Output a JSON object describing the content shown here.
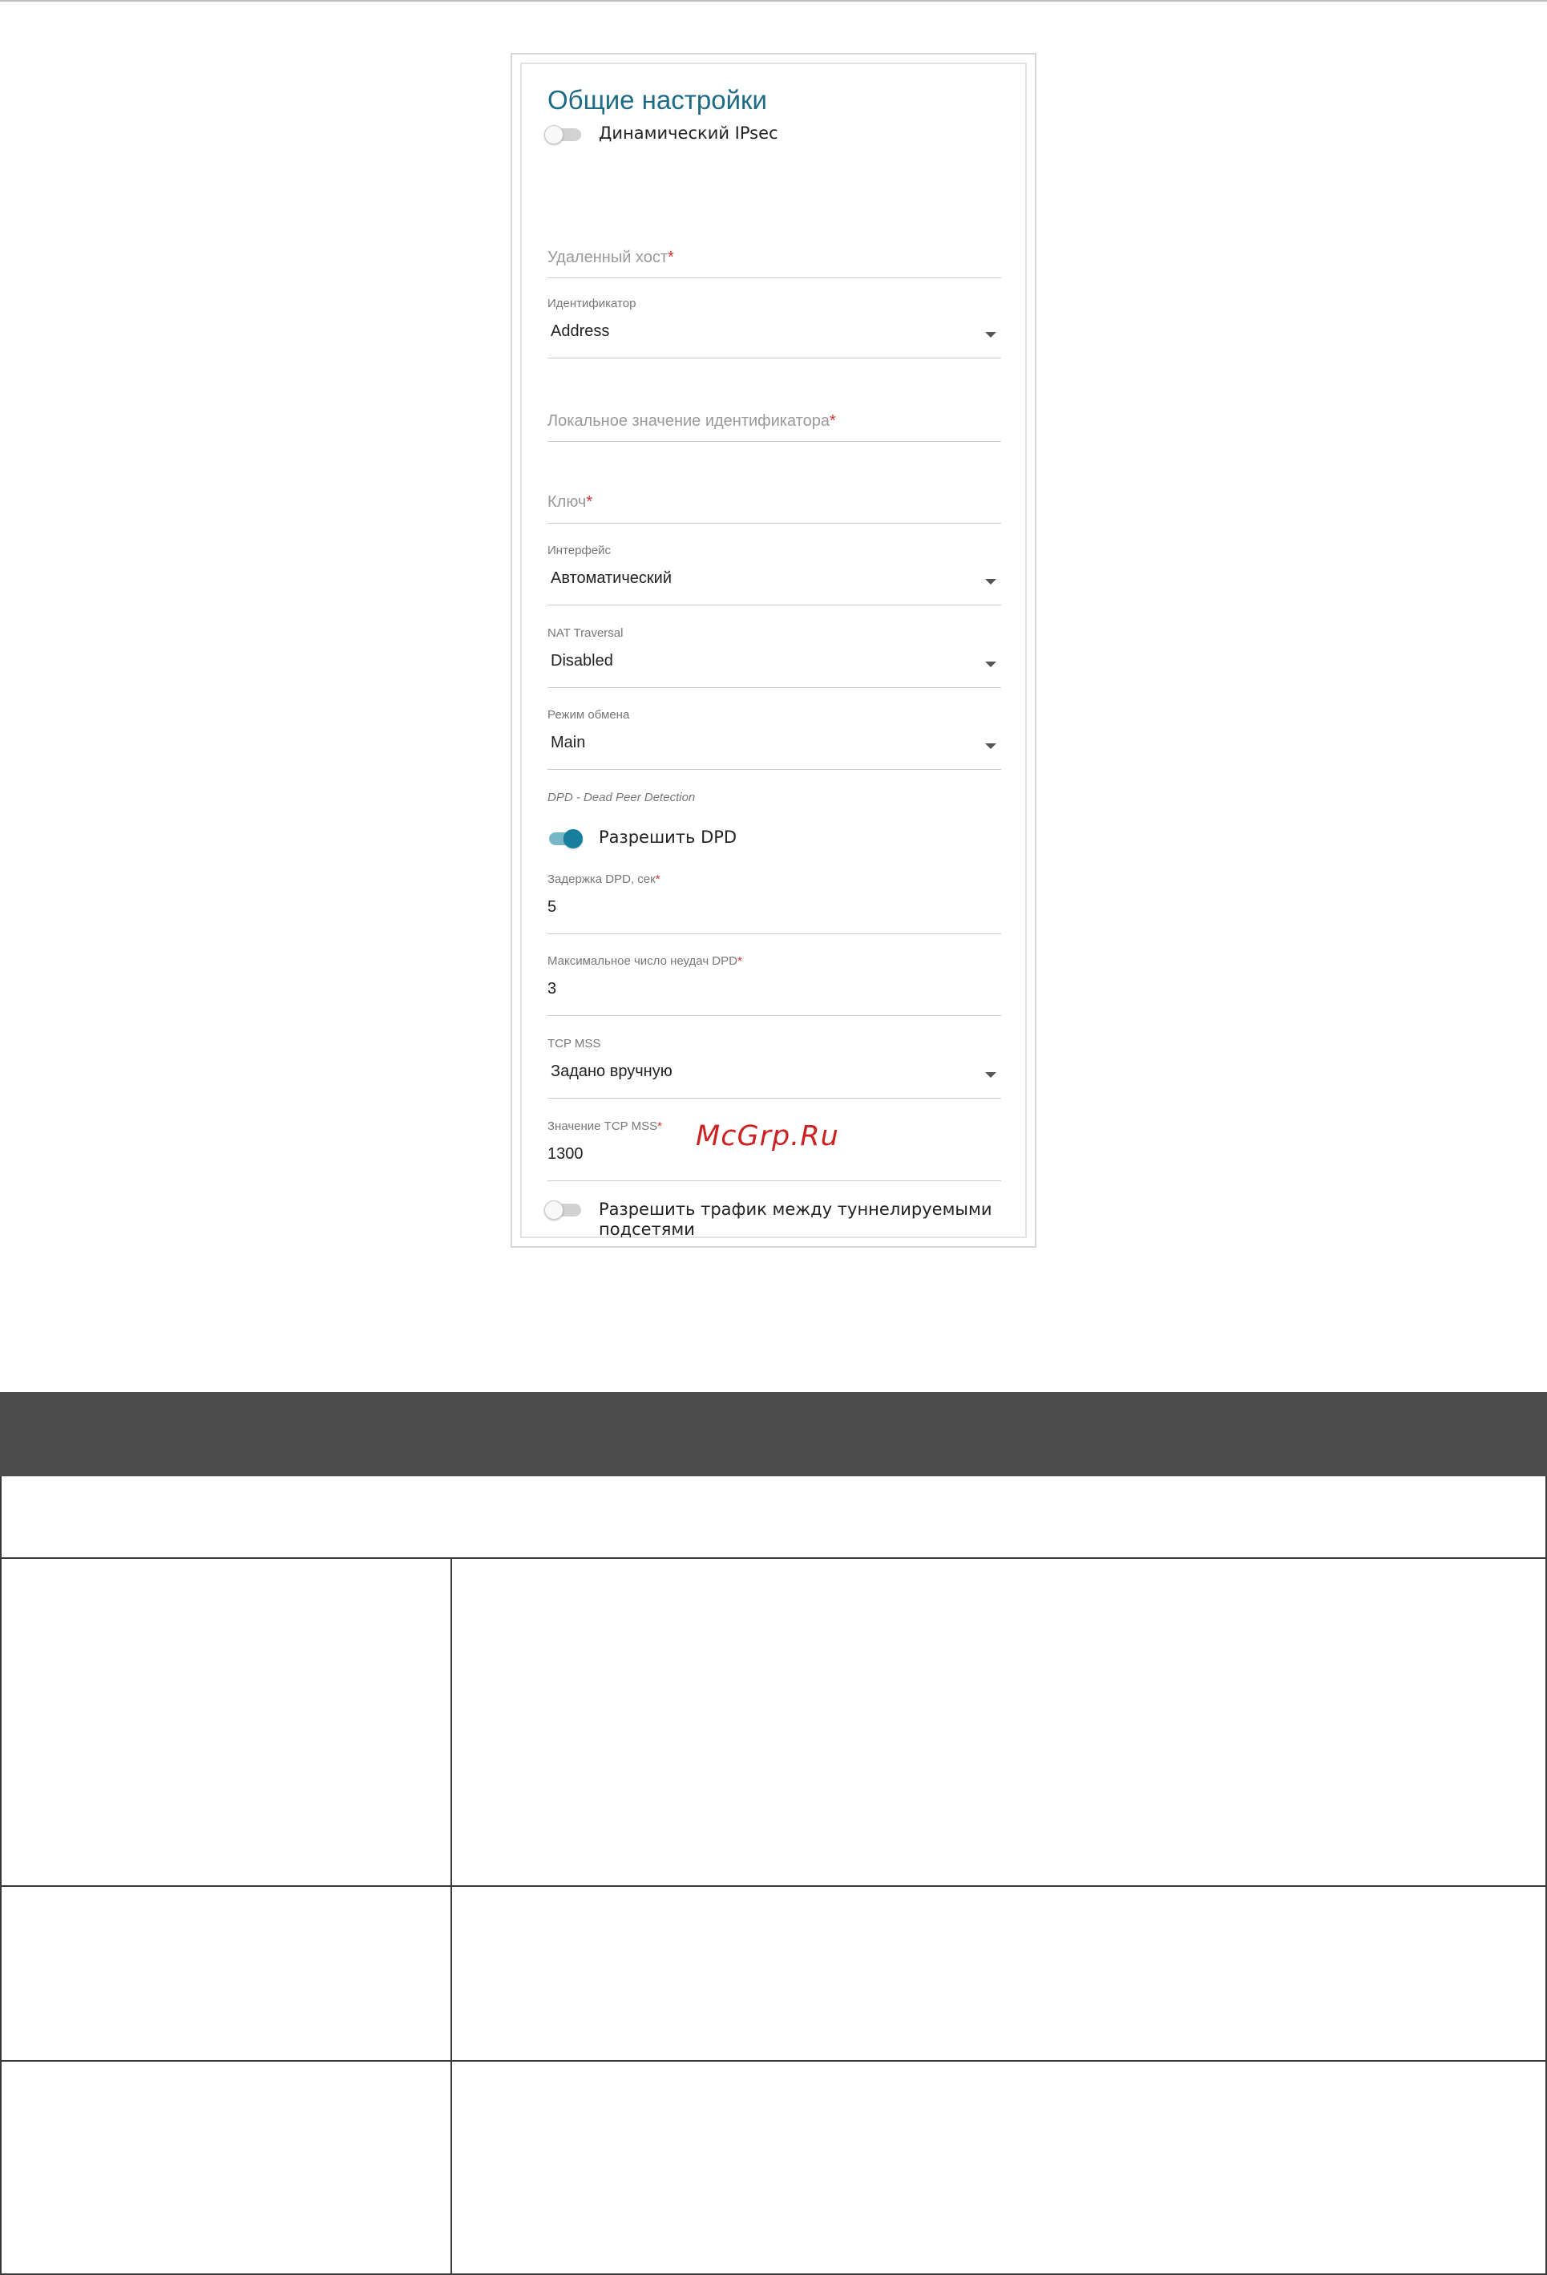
{
  "panel": {
    "title": "Общие настройки",
    "dynamic_ipsec": {
      "label": "Динамический IPsec",
      "enabled": false
    },
    "remote_host": {
      "placeholder": "Удаленный хост",
      "required_mark": "*"
    },
    "identifier": {
      "label": "Идентификатор",
      "value": "Address"
    },
    "local_id_value": {
      "placeholder": "Локальное значение идентификатора",
      "required_mark": "*"
    },
    "key": {
      "placeholder": "Ключ",
      "required_mark": "*"
    },
    "interface": {
      "label": "Интерфейс",
      "value": "Автоматический"
    },
    "nat_traversal": {
      "label": "NAT Traversal",
      "value": "Disabled"
    },
    "exchange_mode": {
      "label": "Режим обмена",
      "value": "Main"
    },
    "dpd_section_label": "DPD - Dead Peer Detection",
    "allow_dpd": {
      "label": "Разрешить DPD",
      "enabled": true
    },
    "dpd_delay": {
      "label": "Задержка DPD, сек",
      "required_mark": "*",
      "value": "5"
    },
    "dpd_max_failures": {
      "label": "Максимальное число неудач DPD",
      "required_mark": "*",
      "value": "3"
    },
    "tcp_mss": {
      "label": "TCP MSS",
      "value": "Задано вручную"
    },
    "tcp_mss_value": {
      "label": "Значение TCP MSS",
      "required_mark": "*",
      "value": "1300"
    },
    "allow_tunnel_traffic": {
      "label_line1": "Разрешить трафик между туннелируемыми",
      "label_line2": "подсетями",
      "enabled": false
    }
  },
  "watermark": "McGrp.Ru",
  "colors": {
    "accent": "#167f9f",
    "title": "#1d6b86",
    "required": "#d32f2f",
    "table_header": "#4c4c4c"
  }
}
